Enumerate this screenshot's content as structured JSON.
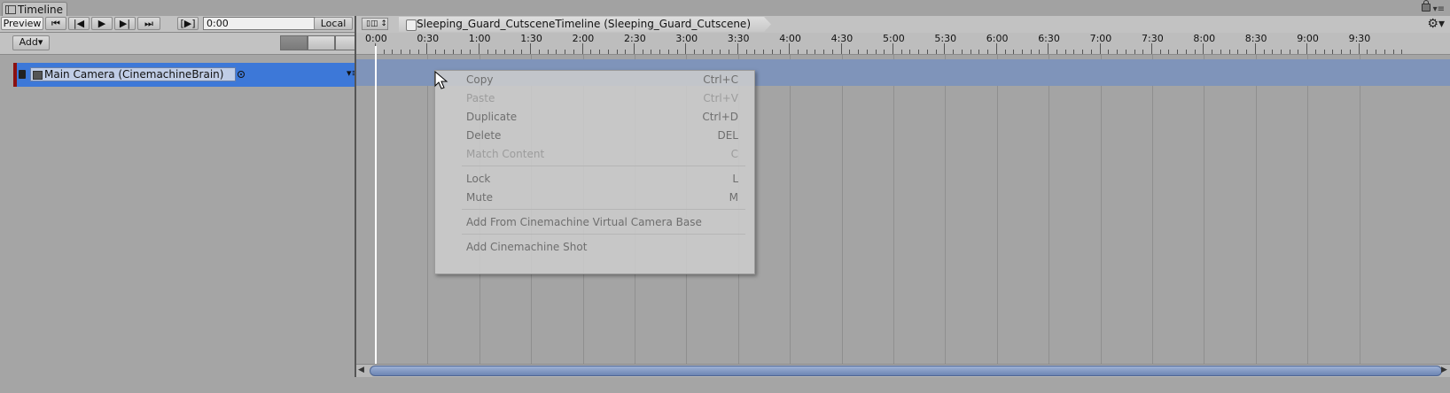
{
  "window": {
    "tab_title": "Timeline"
  },
  "toolbar": {
    "preview": "Preview",
    "time_value": "0:00",
    "local": "Local",
    "add": "Add▾"
  },
  "breadcrumb": {
    "label": "Sleeping_Guard_CutsceneTimeline (Sleeping_Guard_Cutscene)"
  },
  "ruler": {
    "labels": [
      "0:00",
      "0:30",
      "1:00",
      "1:30",
      "2:00",
      "2:30",
      "3:00",
      "3:30",
      "4:00",
      "4:30",
      "5:00",
      "5:30",
      "6:00",
      "6:30",
      "7:00",
      "7:30",
      "8:00",
      "8:30",
      "9:00",
      "9:30"
    ]
  },
  "track": {
    "binding_label": "Main Camera (CinemachineBrain)",
    "track_color": "#8b1111"
  },
  "context_menu": {
    "items": [
      {
        "label": "Copy",
        "shortcut": "Ctrl+C",
        "enabled": true
      },
      {
        "label": "Paste",
        "shortcut": "Ctrl+V",
        "enabled": false
      },
      {
        "label": "Duplicate",
        "shortcut": "Ctrl+D",
        "enabled": true
      },
      {
        "label": "Delete",
        "shortcut": "DEL",
        "enabled": true
      },
      {
        "label": "Match Content",
        "shortcut": "C",
        "enabled": false
      },
      {
        "label": "Lock",
        "shortcut": "L",
        "enabled": true
      },
      {
        "label": "Mute",
        "shortcut": "M",
        "enabled": true
      },
      {
        "label": "Add From Cinemachine Virtual Camera Base",
        "shortcut": "",
        "enabled": true
      },
      {
        "label": "Add Cinemachine Shot",
        "shortcut": "",
        "enabled": true
      }
    ]
  },
  "icons": {
    "toolbar": [
      "jump-to-start-icon",
      "previous-frame-icon",
      "play-icon",
      "next-frame-icon",
      "jump-to-end-icon",
      "play-range-icon"
    ],
    "modes": [
      "mix-mode-icon",
      "ripple-mode-icon",
      "replace-mode-icon"
    ]
  }
}
